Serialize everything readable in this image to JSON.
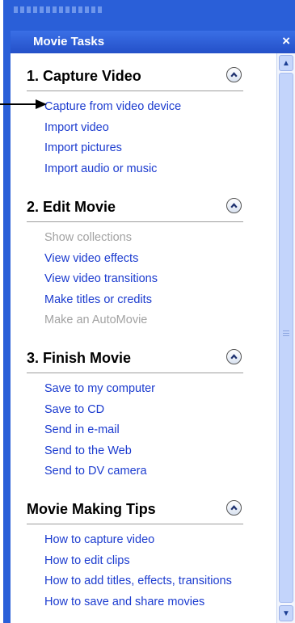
{
  "panel": {
    "title": "Movie Tasks",
    "close_glyph": "×"
  },
  "sections": [
    {
      "title": "1. Capture Video",
      "links": [
        {
          "label": "Capture from video device",
          "enabled": true
        },
        {
          "label": "Import video",
          "enabled": true
        },
        {
          "label": "Import pictures",
          "enabled": true
        },
        {
          "label": "Import audio or music",
          "enabled": true
        }
      ]
    },
    {
      "title": "2. Edit Movie",
      "links": [
        {
          "label": "Show collections",
          "enabled": false
        },
        {
          "label": "View video effects",
          "enabled": true
        },
        {
          "label": "View video transitions",
          "enabled": true
        },
        {
          "label": "Make titles or credits",
          "enabled": true
        },
        {
          "label": "Make an AutoMovie",
          "enabled": false
        }
      ]
    },
    {
      "title": "3. Finish Movie",
      "links": [
        {
          "label": "Save to my computer",
          "enabled": true
        },
        {
          "label": "Save to CD",
          "enabled": true
        },
        {
          "label": "Send in e-mail",
          "enabled": true
        },
        {
          "label": "Send to the Web",
          "enabled": true
        },
        {
          "label": "Send to DV camera",
          "enabled": true
        }
      ]
    },
    {
      "title": "Movie Making Tips",
      "links": [
        {
          "label": "How to capture video",
          "enabled": true
        },
        {
          "label": "How to edit clips",
          "enabled": true
        },
        {
          "label": "How to add titles, effects, transitions",
          "enabled": true
        },
        {
          "label": "How to save and share movies",
          "enabled": true
        }
      ]
    }
  ],
  "colors": {
    "frame": "#2a5fd8",
    "link": "#1b3bcf",
    "disabled_link": "#a2a2a2"
  },
  "icons": {
    "collapse": "chevron-up-icon",
    "close": "close-icon"
  }
}
